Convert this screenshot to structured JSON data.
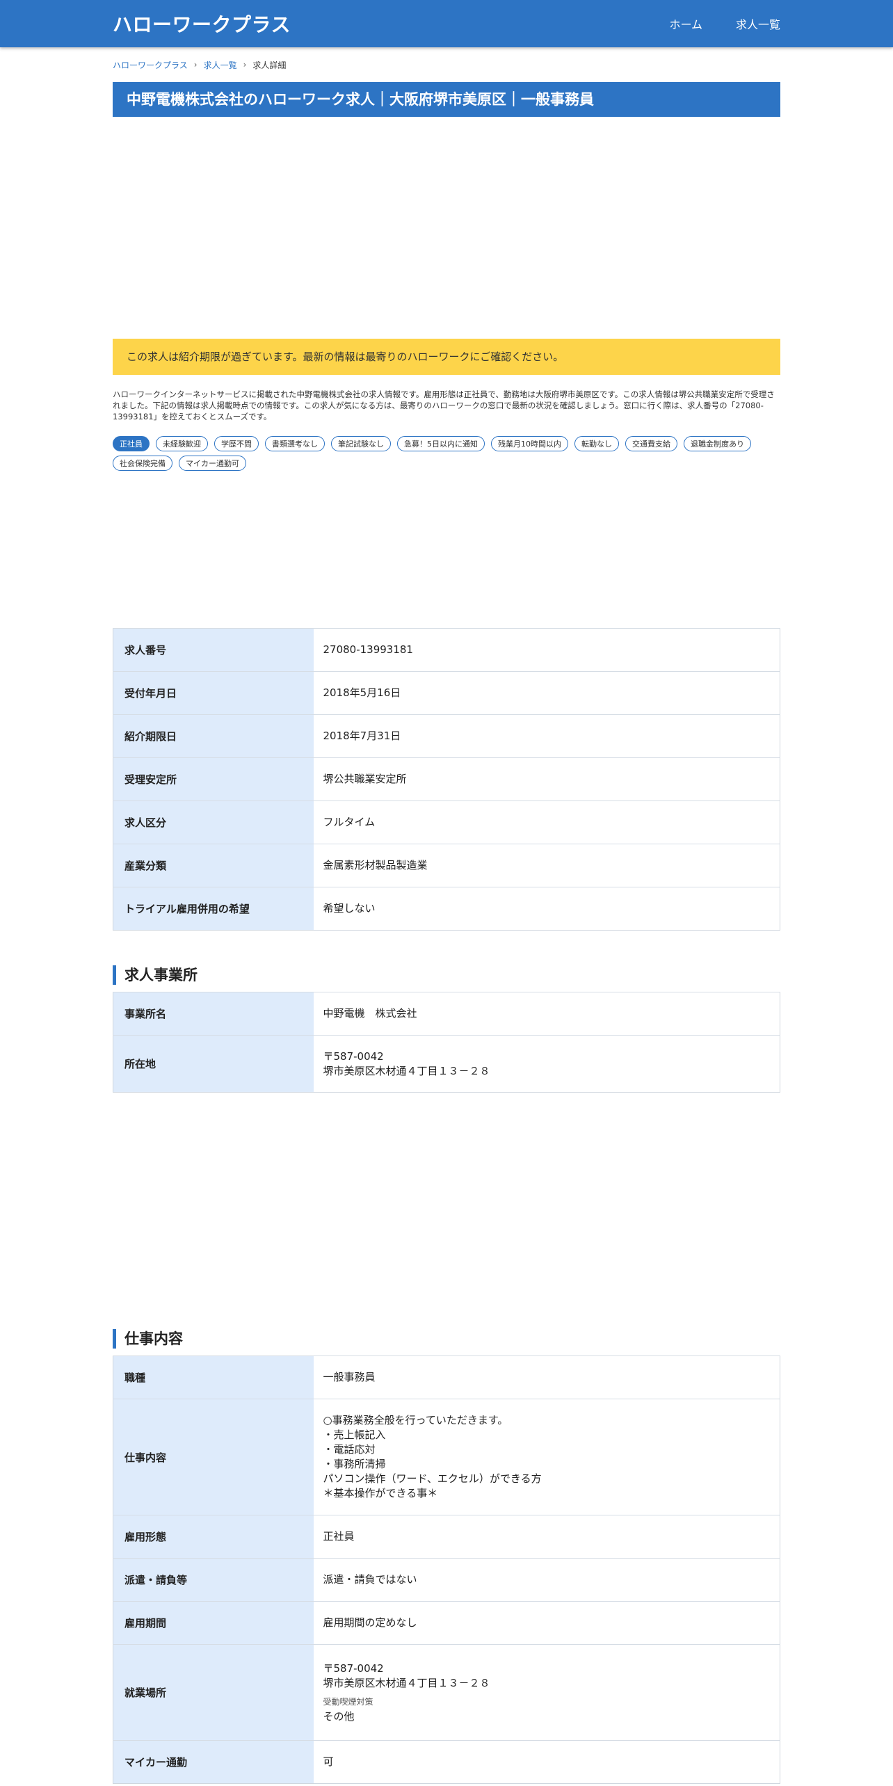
{
  "header": {
    "site_title": "ハローワークプラス",
    "nav": {
      "home": "ホーム",
      "jobs": "求人一覧"
    }
  },
  "breadcrumb": {
    "home": "ハローワークプラス",
    "list": "求人一覧",
    "current": "求人詳細"
  },
  "page_title": "中野電機株式会社のハローワーク求人｜大阪府堺市美原区｜一般事務員",
  "notice": "この求人は紹介期限が過ぎています。最新の情報は最寄りのハローワークにご確認ください。",
  "intro": "ハローワークインターネットサービスに掲載された中野電機株式会社の求人情報です。雇用形態は正社員で、勤務地は大阪府堺市美原区です。この求人情報は堺公共職業安定所で受理されました。下記の情報は求人掲載時点での情報です。この求人が気になる方は、最寄りのハローワークの窓口で最新の状況を確認しましょう。窓口に行く際は、求人番号の「27080-13993181」を控えておくとスムーズです。",
  "tags": [
    {
      "label": "正社員",
      "active": true
    },
    {
      "label": "未経験歓迎",
      "active": false
    },
    {
      "label": "学歴不問",
      "active": false
    },
    {
      "label": "書類選考なし",
      "active": false
    },
    {
      "label": "筆記試験なし",
      "active": false
    },
    {
      "label": "急募！5日以内に通知",
      "active": false
    },
    {
      "label": "残業月10時間以内",
      "active": false
    },
    {
      "label": "転勤なし",
      "active": false
    },
    {
      "label": "交通費支給",
      "active": false
    },
    {
      "label": "退職金制度あり",
      "active": false
    },
    {
      "label": "社会保険完備",
      "active": false
    },
    {
      "label": "マイカー通勤可",
      "active": false
    }
  ],
  "basic_info": [
    {
      "label": "求人番号",
      "value": "27080-13993181"
    },
    {
      "label": "受付年月日",
      "value": "2018年5月16日"
    },
    {
      "label": "紹介期限日",
      "value": "2018年7月31日"
    },
    {
      "label": "受理安定所",
      "value": "堺公共職業安定所"
    },
    {
      "label": "求人区分",
      "value": "フルタイム"
    },
    {
      "label": "産業分類",
      "value": "金属素形材製品製造業"
    },
    {
      "label": "トライアル雇用併用の希望",
      "value": "希望しない"
    }
  ],
  "office": {
    "heading": "求人事業所",
    "rows": [
      {
        "label": "事業所名",
        "value": "中野電機　株式会社"
      },
      {
        "label": "所在地",
        "value": "〒587-0042\n堺市美原区木材通４丁目１３－２８"
      }
    ]
  },
  "work": {
    "heading": "仕事内容",
    "rows": [
      {
        "label": "職種",
        "value": "一般事務員"
      },
      {
        "label": "仕事内容",
        "value": "○事務業務全般を行っていただきます。\n・売上帳記入\n・電話応対\n・事務所清掃\nパソコン操作（ワード、エクセル）ができる方\n＊基本操作ができる事＊"
      },
      {
        "label": "雇用形態",
        "value": "正社員"
      },
      {
        "label": "派遣・請負等",
        "value": "派遣・請負ではない"
      },
      {
        "label": "雇用期間",
        "value": "雇用期間の定めなし"
      },
      {
        "label": "就業場所",
        "value": "〒587-0042\n堺市美原区木材通４丁目１３－２８",
        "sub_label": "受動喫煙対策",
        "sub_value": "その他"
      },
      {
        "label": "マイカー通勤",
        "value": "可"
      }
    ]
  }
}
